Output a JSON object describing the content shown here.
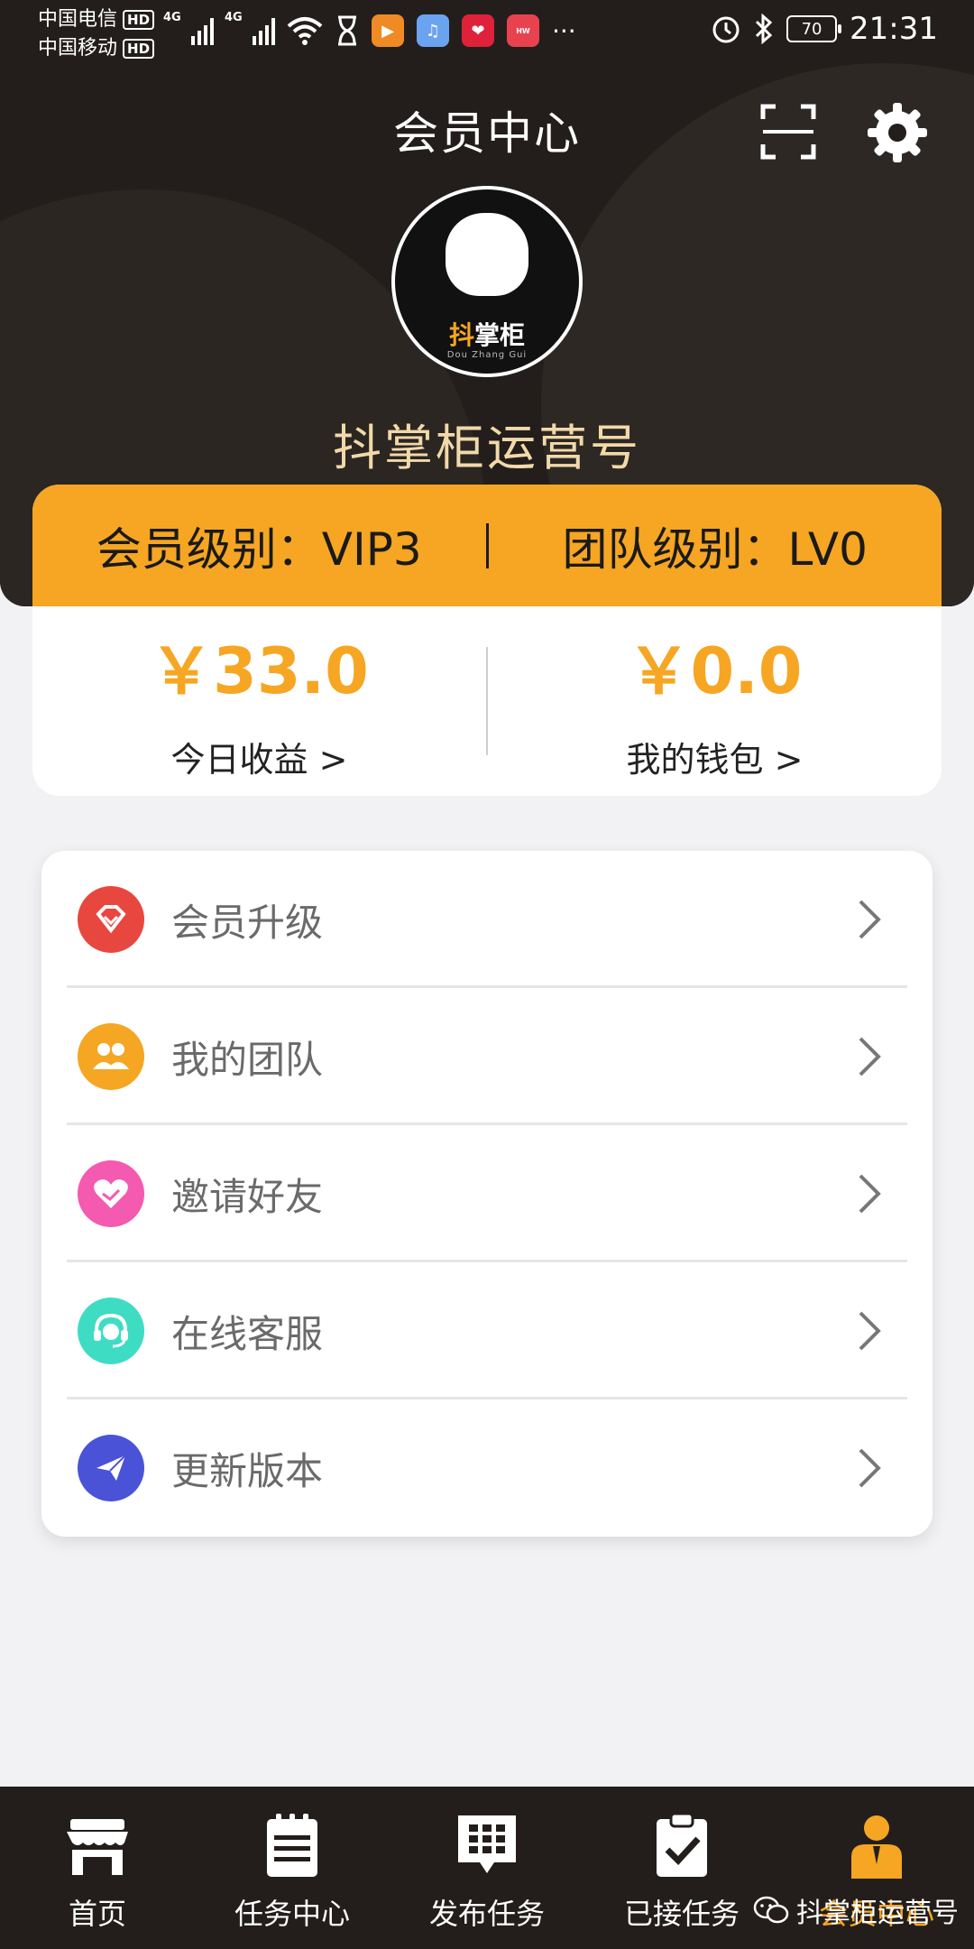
{
  "status_bar": {
    "carrier_1": "中国电信",
    "carrier_2": "中国移动",
    "hd_label": "HD",
    "network_1": "4G",
    "network_2": "4G",
    "battery": "70",
    "time": "21:31",
    "more": "···"
  },
  "header": {
    "title": "会员中心",
    "avatar_logo_first": "抖",
    "avatar_logo_rest": "掌柜",
    "avatar_logo_sub": "Dou Zhang Gui",
    "account_name": "抖掌柜运营号"
  },
  "level": {
    "member_level": "会员级别：VIP3",
    "team_level": "团队级别：LV0",
    "today_income": "￥33.0",
    "today_income_label": "今日收益 >",
    "wallet": "￥0.0",
    "wallet_label": "我的钱包 >"
  },
  "menu": [
    {
      "label": "会员升级",
      "icon": "diamond-icon",
      "color": "#e8473f"
    },
    {
      "label": "我的团队",
      "icon": "team-icon",
      "color": "#f5a623"
    },
    {
      "label": "邀请好友",
      "icon": "heart-handshake-icon",
      "color": "#f45ab0"
    },
    {
      "label": "在线客服",
      "icon": "headset-icon",
      "color": "#3fdcc4"
    },
    {
      "label": "更新版本",
      "icon": "paper-plane-icon",
      "color": "#4a52d8"
    }
  ],
  "nav": [
    {
      "label": "首页",
      "icon": "store-icon"
    },
    {
      "label": "任务中心",
      "icon": "clipboard-list-icon"
    },
    {
      "label": "发布任务",
      "icon": "grid-publish-icon"
    },
    {
      "label": "已接任务",
      "icon": "clipboard-check-icon"
    },
    {
      "label": "会员中心",
      "icon": "member-icon",
      "active": true
    }
  ],
  "watermark": "抖掌柜运营号",
  "colors": {
    "accent": "#f6a623",
    "header_bg": "#231e1b",
    "account_name": "#f1d9a9"
  }
}
